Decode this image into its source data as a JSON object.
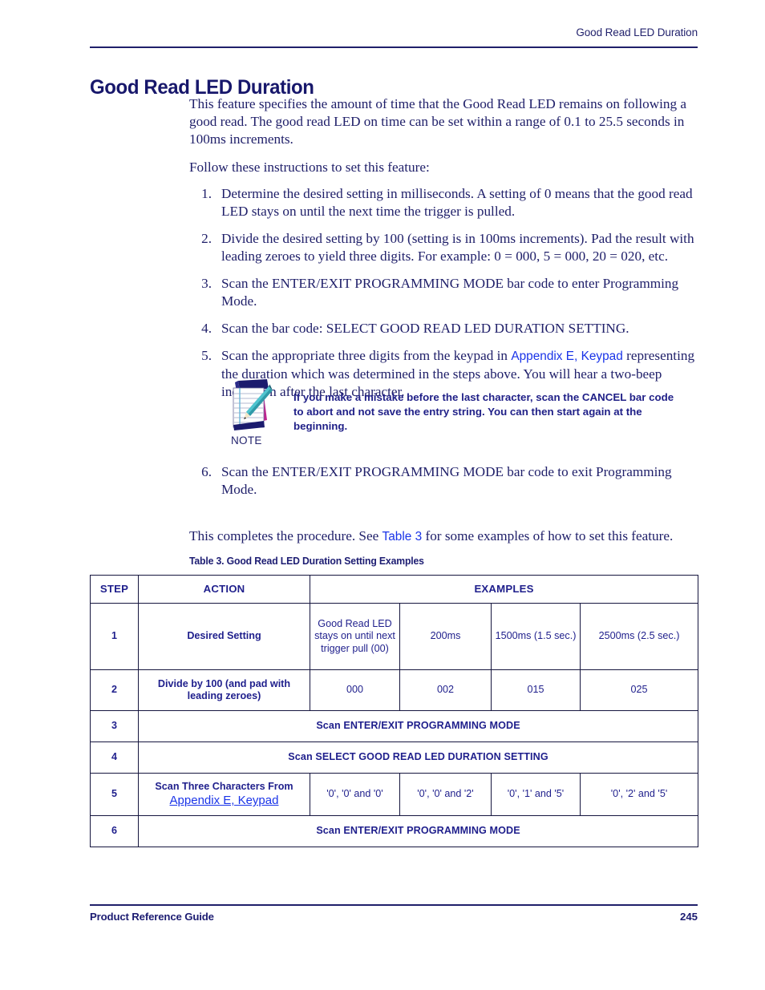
{
  "header": {
    "running_head": "Good Read LED Duration"
  },
  "title": "Good Read LED Duration",
  "body": {
    "intro": "This feature specifies the amount of time that the Good Read LED remains on following a good read. The good read LED on time can be set within a range of 0.1 to 25.5 seconds in 100ms increments.",
    "follow": "Follow these instructions to set this feature:",
    "steps": [
      {
        "num": "1.",
        "text": "Determine the desired setting in milliseconds. A setting of 0 means that the good read LED stays on until the next time the trigger is pulled."
      },
      {
        "num": "2.",
        "text": "Divide the desired setting by 100 (setting is in 100ms increments). Pad the result with leading zeroes to yield three digits. For example: 0 = 000, 5 = 000, 20 = 020, etc."
      },
      {
        "num": "3.",
        "text": "Scan the ENTER/EXIT PROGRAMMING MODE bar code to enter Programming Mode."
      },
      {
        "num": "4.",
        "text": "Scan the bar code: SELECT GOOD READ LED DURATION SETTING."
      }
    ],
    "step5": {
      "num": "5.",
      "before": "Scan the appropriate three digits from the keypad in ",
      "link": "Appendix E, Keypad",
      "after": " representing the duration which was determined in the steps above. You will hear a two-beep indication after the last character."
    },
    "step6": {
      "num": "6.",
      "text": "Scan the ENTER/EXIT PROGRAMMING MODE bar code to exit Programming Mode."
    },
    "closing": {
      "before": "This completes the procedure. See ",
      "link": "Table 3",
      "after": " for some examples of how to set this feature."
    }
  },
  "note": {
    "label": "NOTE",
    "icon": "notepad-pencil-icon",
    "text": "If you make a mistake before the last character, scan the CANCEL bar code to abort and not save the entry string. You can then start again at the beginning."
  },
  "table": {
    "caption": "Table 3. Good Read LED Duration Setting Examples",
    "columns": [
      "STEP",
      "ACTION",
      "EXAMPLES"
    ],
    "rows": [
      {
        "step": "1",
        "action": "Desired Setting",
        "examples": [
          "Good Read LED stays on until next trigger pull (00)",
          "200ms",
          "1500ms (1.5 sec.)",
          "2500ms (2.5 sec.)"
        ]
      },
      {
        "step": "2",
        "action": "Divide by 100 (and pad with leading zeroes)",
        "examples": [
          "000",
          "002",
          "015",
          "025"
        ]
      },
      {
        "step": "3",
        "span_text": "Scan ENTER/EXIT PROGRAMMING MODE"
      },
      {
        "step": "4",
        "span_text": "Scan SELECT GOOD READ LED DURATION SETTING"
      },
      {
        "step": "5",
        "action": "Scan Three Characters From",
        "action_link": "Appendix E, Keypad",
        "examples": [
          "'0', '0' and '0'",
          "'0', '0' and '2'",
          "'0', '1' and '5'",
          "'0', '2' and '5'"
        ]
      },
      {
        "step": "6",
        "span_text": "Scan ENTER/EXIT PROGRAMMING MODE"
      }
    ]
  },
  "footer": {
    "left": "Product Reference Guide",
    "page": "245"
  },
  "colors": {
    "navy": "#20206a",
    "link_blue": "#1a34e8",
    "table_border": "#16163f",
    "table_text": "#1f1f8c"
  }
}
